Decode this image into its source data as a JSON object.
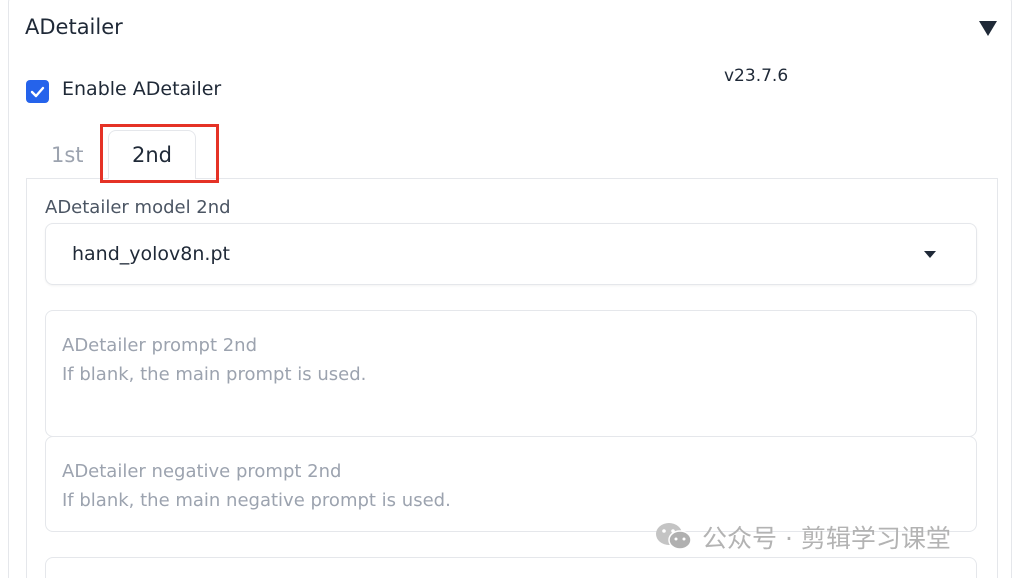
{
  "section": {
    "title": "ADetailer",
    "collapse_icon": "triangle-down-icon"
  },
  "enable": {
    "label": "Enable ADetailer",
    "checked": true,
    "accent_color": "#2563eb"
  },
  "version": "v23.7.6",
  "tabs": [
    {
      "label": "1st",
      "active": false
    },
    {
      "label": "2nd",
      "active": true
    }
  ],
  "highlight_color": "#e53226",
  "model": {
    "label": "ADetailer model 2nd",
    "value": "hand_yolov8n.pt",
    "icon": "caret-down-icon"
  },
  "prompt": {
    "placeholder_line1": "ADetailer prompt 2nd",
    "placeholder_line2": "If blank, the main prompt is used."
  },
  "negative_prompt": {
    "placeholder_line1": "ADetailer negative prompt 2nd",
    "placeholder_line2": "If blank, the main negative prompt is used."
  },
  "watermark": {
    "text": "公众号 · 剪辑学习课堂",
    "icon": "wechat-icon"
  }
}
